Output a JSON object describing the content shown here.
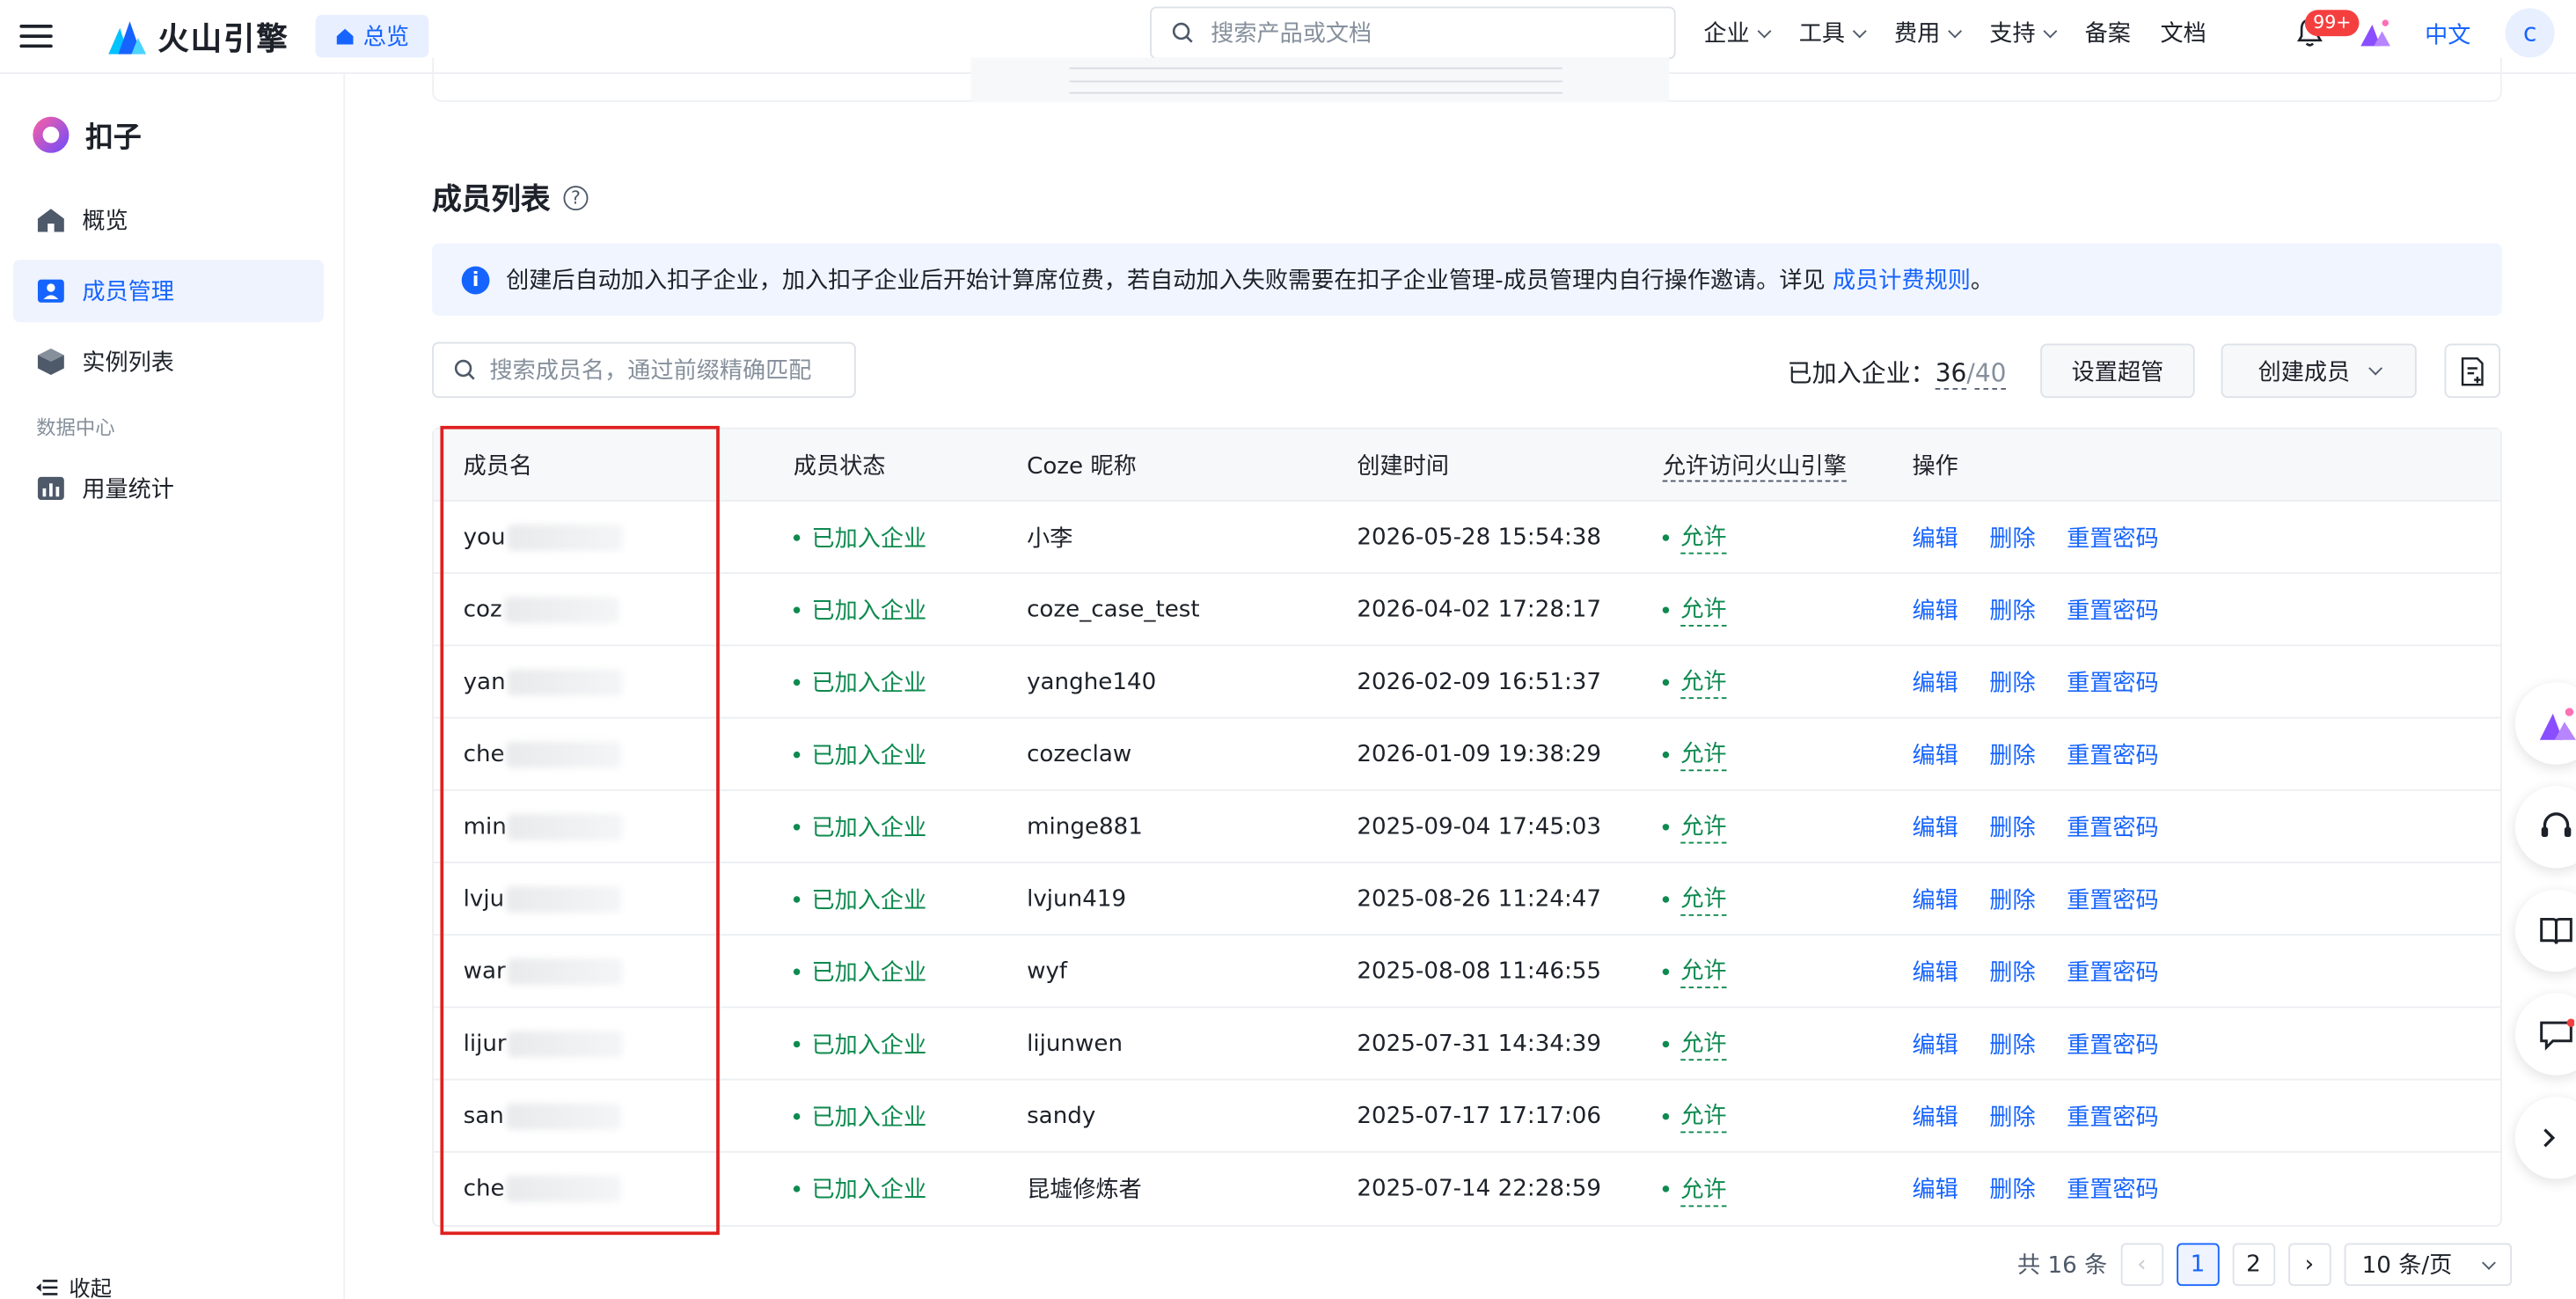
{
  "topbar": {
    "brand": "火山引擎",
    "home_tab": "总览",
    "search_placeholder": "搜索产品或文档",
    "nav": [
      "企业",
      "工具",
      "费用",
      "支持"
    ],
    "links": [
      "备案",
      "文档"
    ],
    "badge": "99+",
    "language": "中文",
    "avatar": "c"
  },
  "sidebar": {
    "app_name": "扣子",
    "items": [
      {
        "label": "概览",
        "icon": "home-icon"
      },
      {
        "label": "成员管理",
        "icon": "member-icon",
        "active": true
      },
      {
        "label": "实例列表",
        "icon": "cube-icon"
      }
    ],
    "section": "数据中心",
    "data_items": [
      {
        "label": "用量统计",
        "icon": "chart-icon"
      }
    ],
    "collapse": "收起"
  },
  "main": {
    "title": "成员列表",
    "alert_text": "创建后自动加入扣子企业，加入扣子企业后开始计算席位费，若自动加入失败需要在扣子企业管理-成员管理内自行操作邀请。详见",
    "alert_link": "成员计费规则",
    "alert_end": "。",
    "member_search_placeholder": "搜索成员名，通过前缀精确匹配",
    "joined_label": "已加入企业：",
    "joined_count": "36",
    "joined_sep": "/",
    "joined_max": "40",
    "set_admin": "设置超管",
    "create_member": "创建成员"
  },
  "table": {
    "headers": [
      "成员名",
      "成员状态",
      "Coze 昵称",
      "创建时间",
      "允许访问火山引擎",
      "操作"
    ],
    "rows": [
      {
        "name": "you",
        "status": "已加入企业",
        "nickname": "小李",
        "created": "2026-05-28 15:54:38",
        "access": "允许"
      },
      {
        "name": "coz",
        "status": "已加入企业",
        "nickname": "coze_case_test",
        "created": "2026-04-02 17:28:17",
        "access": "允许"
      },
      {
        "name": "yan",
        "status": "已加入企业",
        "nickname": "yanghe140",
        "created": "2026-02-09 16:51:37",
        "access": "允许"
      },
      {
        "name": "che",
        "status": "已加入企业",
        "nickname": "cozeclaw",
        "created": "2026-01-09 19:38:29",
        "access": "允许"
      },
      {
        "name": "min",
        "status": "已加入企业",
        "nickname": "minge881",
        "created": "2025-09-04 17:45:03",
        "access": "允许"
      },
      {
        "name": "lvju",
        "status": "已加入企业",
        "nickname": "lvjun419",
        "created": "2025-08-26 11:24:47",
        "access": "允许"
      },
      {
        "name": "war",
        "status": "已加入企业",
        "nickname": "wyf",
        "created": "2025-08-08 11:46:55",
        "access": "允许"
      },
      {
        "name": "lijur",
        "status": "已加入企业",
        "nickname": "lijunwen",
        "created": "2025-07-31 14:34:39",
        "access": "允许"
      },
      {
        "name": "san",
        "status": "已加入企业",
        "nickname": "sandy",
        "created": "2025-07-17 17:17:06",
        "access": "允许"
      },
      {
        "name": "che",
        "status": "已加入企业",
        "nickname": "昆墟修炼者",
        "created": "2025-07-14 22:28:59",
        "access": "允许"
      }
    ],
    "actions": [
      "编辑",
      "删除",
      "重置密码"
    ]
  },
  "pager": {
    "total": "共 16 条",
    "pages": [
      "1",
      "2"
    ],
    "size": "10 条/页"
  },
  "colors": {
    "accent": "#1664ff",
    "success": "#0e8a4f",
    "highlight_box": "#e02020"
  }
}
